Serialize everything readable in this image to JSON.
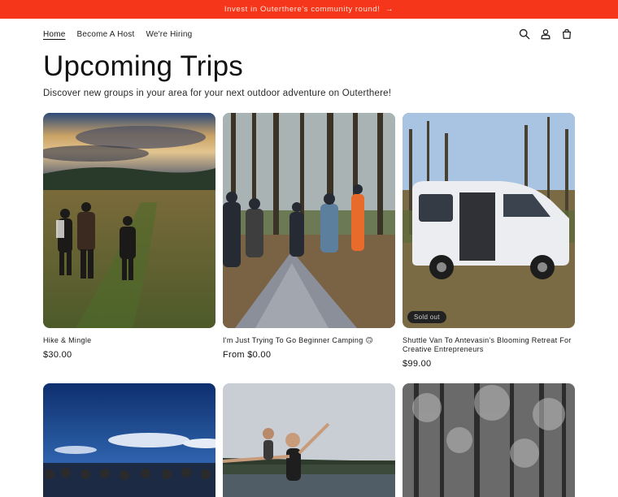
{
  "announcement": {
    "text": "Invest in Outerthere's community round!",
    "arrow": "→"
  },
  "nav": {
    "items": [
      "Home",
      "Become A Host",
      "We're Hiring"
    ]
  },
  "header_icons": [
    "search-icon",
    "account-icon",
    "cart-icon"
  ],
  "page": {
    "title": "Upcoming Trips",
    "subtitle": "Discover new groups in your area for your next outdoor adventure on Outerthere!"
  },
  "products": [
    {
      "name": "Hike & Mingle",
      "price": "$30.00"
    },
    {
      "name": "I'm Just Trying To Go Beginner Camping 🙃",
      "price": "From $0.00"
    },
    {
      "name": "Shuttle Van To Antevasin's Blooming Retreat For Creative Entrepreneurs",
      "price": "$99.00",
      "badge": "Sold out"
    }
  ],
  "colors": {
    "announcement_bg": "#f5361a",
    "text": "#121212"
  }
}
